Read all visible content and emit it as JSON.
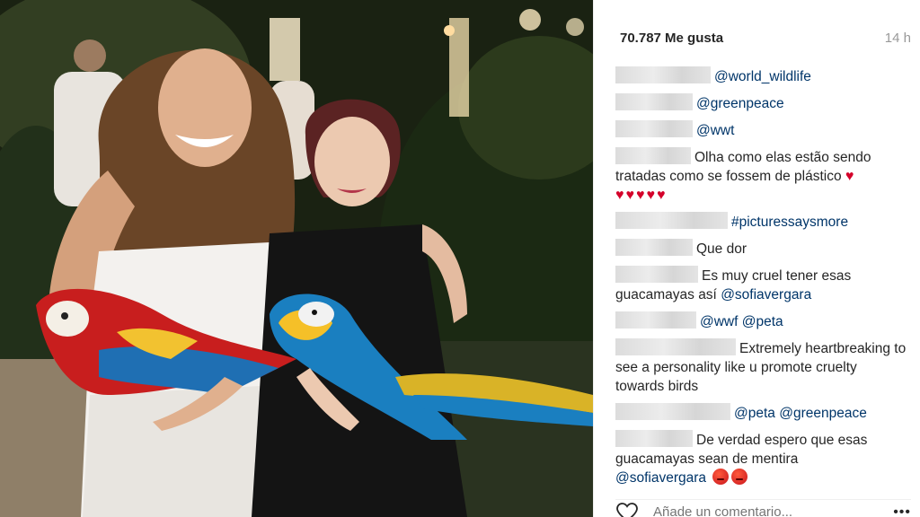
{
  "post": {
    "likes": "70.787 Me gusta",
    "time": "14 h"
  },
  "comments": [
    {
      "mention": "@world_wildlife"
    },
    {
      "mention": "@greenpeace"
    },
    {
      "mention": "@wwt"
    },
    {
      "text": "Olha como elas estão sendo tratadas como se fossem de plástico",
      "hearts": "♥",
      "hearts_row": "♥♥♥♥♥"
    },
    {
      "mention": "#picturessaysmore"
    },
    {
      "text": "Que dor"
    },
    {
      "text": "Es muy cruel tener esas guacamayas así",
      "mention": "@sofiavergara"
    },
    {
      "mention": "@wwf",
      "mention2": "@peta"
    },
    {
      "text": "Extremely heartbreaking to see a personality like u promote cruelty towards birds"
    },
    {
      "mention": "@peta",
      "mention2": "@greenpeace"
    },
    {
      "text": "De verdad espero que esas guacamayas sean de mentira",
      "mention": "@sofiavergara"
    }
  ],
  "add_comment": {
    "placeholder": "Añade un comentario...",
    "more": "•••"
  },
  "icons": {
    "like": "heart-outline-icon",
    "more": "more-options-icon",
    "broken_heart": "broken-heart-emoji",
    "angry": "angry-face-emoji"
  },
  "colors": {
    "mention": "#003569",
    "text": "#262626",
    "muted": "#999999",
    "heart": "#d4002a"
  }
}
